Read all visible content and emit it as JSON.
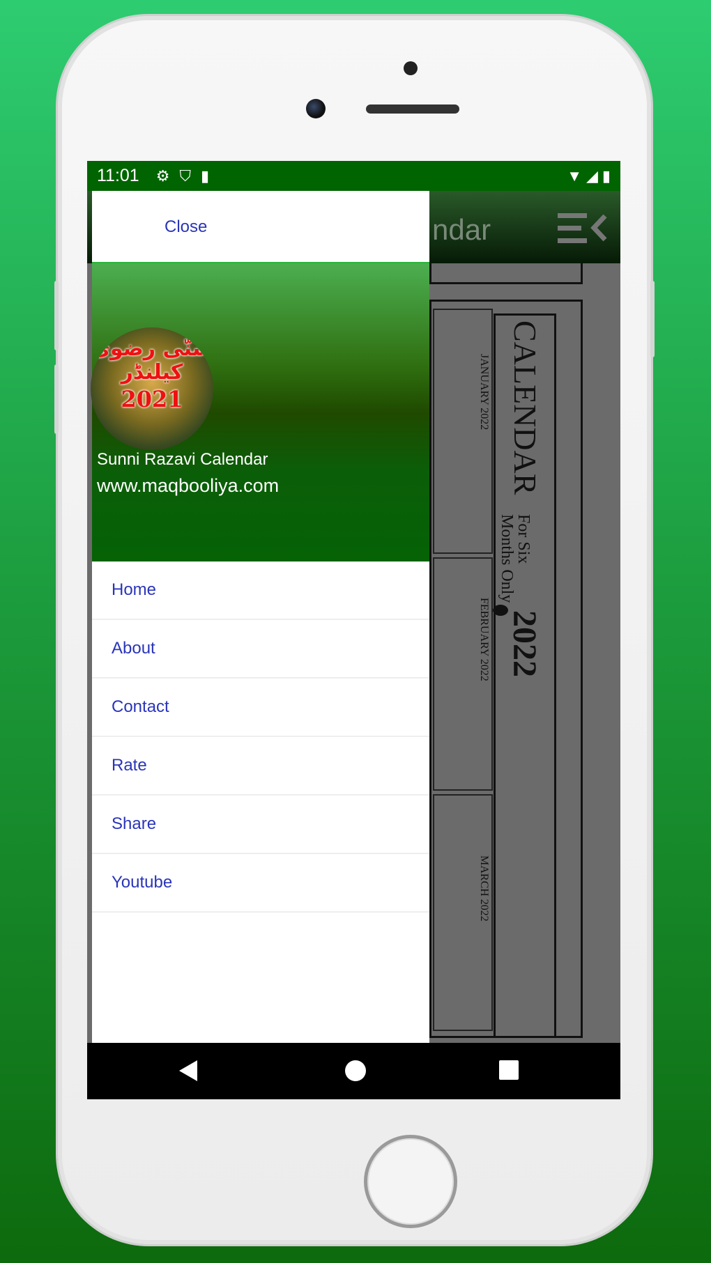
{
  "status_bar": {
    "time": "11:01",
    "left_icons": [
      "gear-icon",
      "shield-play-icon",
      "sd-card-icon"
    ],
    "right_icons": [
      "wifi-icon",
      "signal-icon",
      "battery-icon"
    ]
  },
  "app_bar": {
    "title": "ndar",
    "menu_icon": "menu-close-icon"
  },
  "drawer": {
    "close_label": "Close",
    "header": {
      "logo_urdu": "سنّی رضوی کیلنڈر",
      "logo_year": "2021",
      "app_name": "Sunni Razavi Calendar",
      "website": "www.maqbooliya.com"
    },
    "items": [
      {
        "label": "Home"
      },
      {
        "label": "About"
      },
      {
        "label": "Contact"
      },
      {
        "label": "Rate"
      },
      {
        "label": "Share"
      },
      {
        "label": "Youtube"
      }
    ]
  },
  "calendar_image": {
    "title": "CALENDAR",
    "subtitle_1": "For Six",
    "subtitle_2": "Months Only",
    "year": "2022",
    "months": [
      "JANUARY 2022",
      "FEBRUARY 2022",
      "MARCH 2022"
    ]
  },
  "nav_bar": {
    "icons": [
      "back-icon",
      "home-icon",
      "recents-icon"
    ]
  },
  "colors": {
    "status_bar": "#006400",
    "accent_text": "#2a35b8",
    "header_green": "#056205"
  }
}
